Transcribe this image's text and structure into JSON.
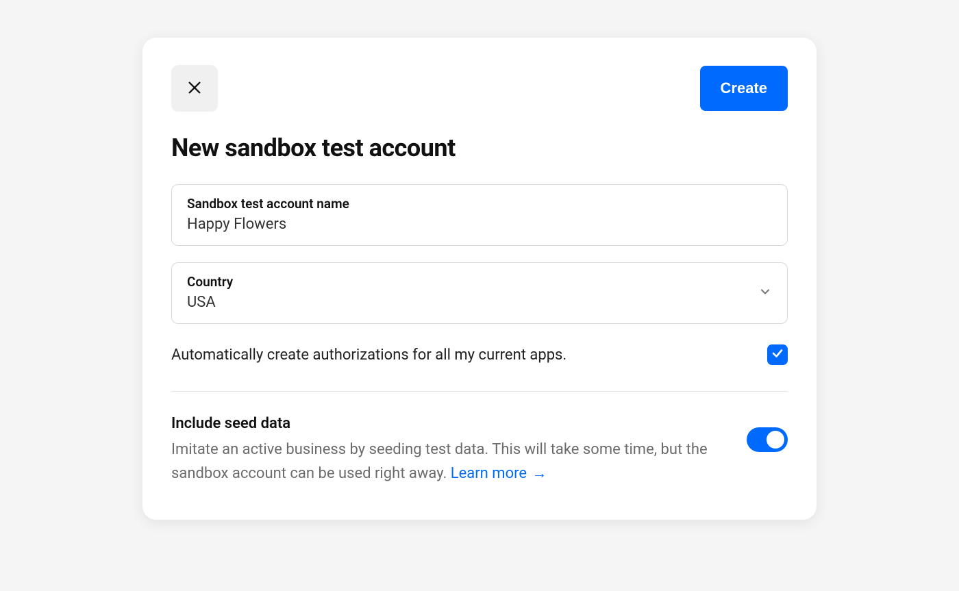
{
  "header": {
    "create_label": "Create"
  },
  "title": "New sandbox test account",
  "fields": {
    "name": {
      "label": "Sandbox test account name",
      "value": "Happy Flowers"
    },
    "country": {
      "label": "Country",
      "value": "USA"
    }
  },
  "authorizations": {
    "text": "Automatically create authorizations for all my current apps.",
    "checked": true
  },
  "seed": {
    "title": "Include seed data",
    "description": "Imitate an active business by seeding test data. This will take some time, but the sandbox account can be used right away. ",
    "learn_more": "Learn more",
    "arrow": "→",
    "enabled": true
  }
}
